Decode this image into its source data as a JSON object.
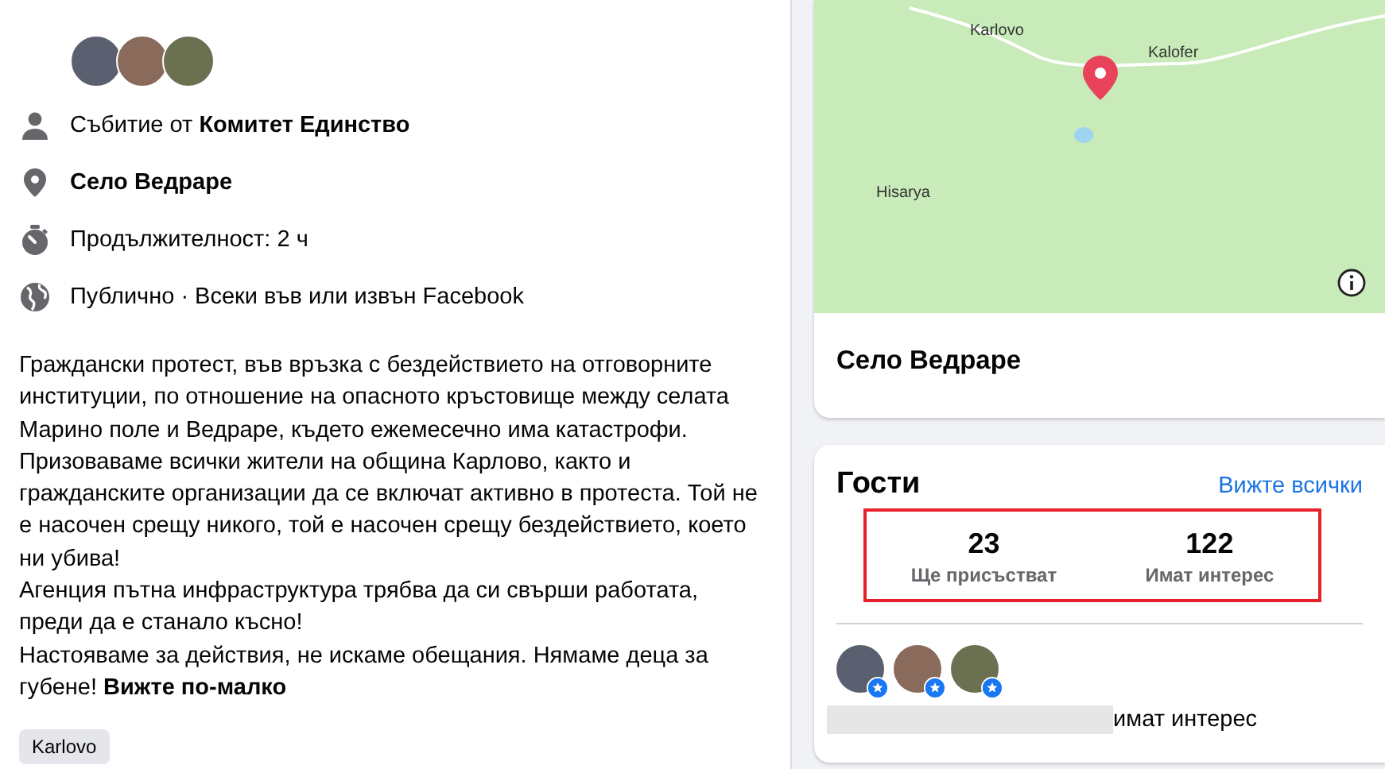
{
  "details": {
    "rows": [
      {
        "kind": "organizer",
        "text": "Събитие от **Комитет Единство**"
      },
      {
        "kind": "location",
        "text": "Село Ведраре"
      },
      {
        "kind": "duration",
        "text": "Продължителност: 2 ч"
      },
      {
        "kind": "privacy",
        "text": "Публично · Всеки във или извън Facebook"
      }
    ],
    "description": [
      "Граждански протест, във връзка с бездействието на отговорните институции, по отношение на опасното кръстовище между селата Марино поле и Ведраре, където ежемесечно има катастрофи.",
      "Призоваваме всички жители на община Карлово, както и гражданските организации да се включат активно в протеста. Той не е насочен срещу никого, той е насочен срещу бездействието, което ни убива!",
      "Агенция пътна инфраструктура трябва да си свърши работата, преди да е станало късно!",
      "Настояваме за действия, не искаме обещания. Нямаме деца за губене!"
    ],
    "see_less": "Вижте по-малко",
    "tags": [
      "Karlovo"
    ]
  },
  "map_card": {
    "labels": [
      "Karlovo",
      "Kalofer",
      "Hisarya"
    ],
    "place": "Село Ведраре"
  },
  "guests": {
    "title": "Гости",
    "see_all": "Вижте всички",
    "highlighted": true,
    "stats": [
      {
        "count": "23",
        "label": "Ще присъстват"
      },
      {
        "count": "122",
        "label": "Имат интерес"
      }
    ],
    "interested_text": "имат интерес"
  }
}
